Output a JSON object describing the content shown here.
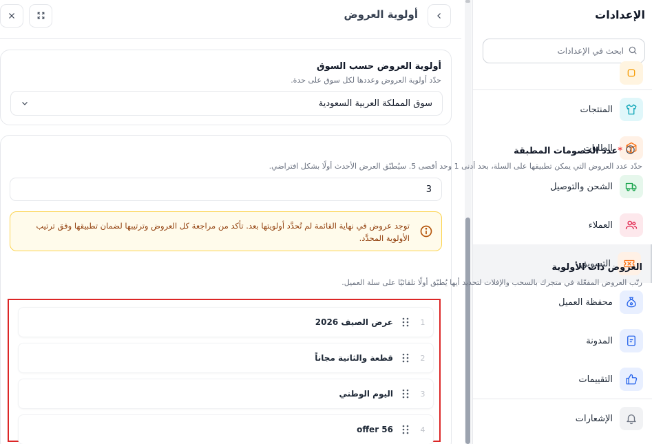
{
  "sidebar": {
    "title": "الإعدادات",
    "search_placeholder": "ابحث في الإعدادات",
    "items": [
      {
        "label": "المنتجات",
        "icon": "shirt-icon",
        "color": "#0ea5b7",
        "bg": "#e0f7fa"
      },
      {
        "label": "الطلبات",
        "icon": "box-icon",
        "color": "#f97316",
        "bg": "#fff1e6"
      },
      {
        "label": "الشحن والتوصيل",
        "icon": "truck-icon",
        "color": "#16a34a",
        "bg": "#e6f7ec"
      },
      {
        "label": "العملاء",
        "icon": "users-icon",
        "color": "#e11d48",
        "bg": "#fde8ec"
      },
      {
        "label": "التسويق",
        "icon": "ticket-icon",
        "color": "#f97316",
        "bg": "#fff1e6"
      },
      {
        "label": "محفظة العميل",
        "icon": "money-bag-icon",
        "color": "#2563eb",
        "bg": "#e8efff"
      },
      {
        "label": "المدونة",
        "icon": "note-icon",
        "color": "#2563eb",
        "bg": "#e8efff"
      },
      {
        "label": "التقييمات",
        "icon": "thumbs-up-icon",
        "color": "#2563eb",
        "bg": "#e8efff"
      },
      {
        "label": "الإشعارات",
        "icon": "bell-icon",
        "color": "#6b7280",
        "bg": "#f1f2f4"
      }
    ]
  },
  "panel": {
    "title": "أولوية العروض"
  },
  "market": {
    "heading": "أولوية العروض حسب السوق",
    "description": "حدّد أولوية العروض وعددها لكل سوق على حدة.",
    "selected": "سوق المملكة العربية السعودية"
  },
  "discounts": {
    "heading": "عدد الخصومات المطبقة",
    "required_mark": "*",
    "description": "حدّد عدد العروض التي يمكن تطبيقها على السلة، بحد أدنى 1 وحد أقصى 5. سيُطبّق العرض الأحدث أولًا بشكل افتراضي.",
    "value": "3"
  },
  "alert": {
    "text": "توجد عروض في نهاية القائمة لم تُحدَّد أولويتها بعد. تأكد من مراجعة كل العروض وترتيبها لضمان تطبيقها وفق ترتيب الأولوية المحدَّد.",
    "color": "#fcd34d"
  },
  "priority": {
    "heading": "العروض ذات الأولوية",
    "description": "رتّب العروض المفعّلة في متجرك بالسحب والإفلات لتحديد أيها يُطبّق أولًا تلقائيًا على سلة العميل.",
    "offers": [
      {
        "index": "1",
        "name": "عرض الصيف 2026"
      },
      {
        "index": "2",
        "name": "قطعة والثانية مجاناً"
      },
      {
        "index": "3",
        "name": "اليوم الوطني"
      },
      {
        "index": "4",
        "name": "offer 56"
      }
    ]
  }
}
